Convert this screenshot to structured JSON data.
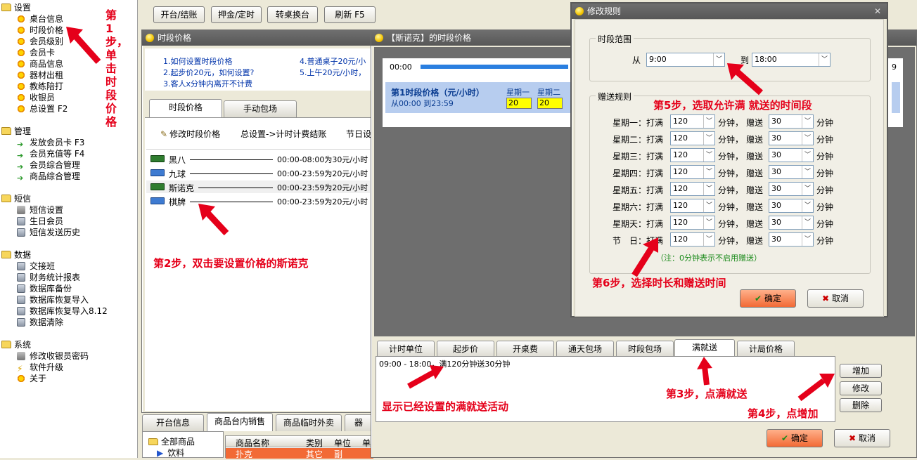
{
  "sidebar": {
    "groups": [
      {
        "label": "设置",
        "items": [
          "桌台信息",
          "时段价格",
          "会员级别",
          "会员卡",
          "商品信息",
          "器材出租",
          "教练陪打",
          "收银员",
          "总设置 F2"
        ]
      },
      {
        "label": "管理",
        "items": [
          "发放会员卡 F3",
          "会员充值等 F4",
          "会员综合管理",
          "商品综合管理"
        ]
      },
      {
        "label": "短信",
        "items": [
          "短信设置",
          "生日会员",
          "短信发送历史"
        ]
      },
      {
        "label": "数据",
        "items": [
          "交接班",
          "财务统计报表",
          "数据库备份",
          "数据库恢复导入",
          "数据库恢复导入8.12",
          "数据清除"
        ]
      },
      {
        "label": "系统",
        "items": [
          "修改收银员密码",
          "软件升级",
          "关于"
        ]
      }
    ]
  },
  "toolbar": {
    "btn1": "开台/结账",
    "btn2": "押金/定时",
    "btn3": "转桌换台",
    "btn4": "刷新 F5"
  },
  "step1": "第1步，单击时段价格",
  "win1": {
    "title": "时段价格",
    "tips": [
      "1.如何设置时段价格",
      "2.起步价20元，如何设置?",
      "3.客人x分钟内离开不计费",
      "4.普通桌子20元/小",
      "5.上午20元/小时，"
    ],
    "tabs": [
      "时段价格",
      "手动包场"
    ],
    "actions": [
      "修改时段价格",
      "总设置->计时计费结账",
      "节日设"
    ],
    "rows": [
      {
        "name": "黑八",
        "price": "00:00-08:00为30元/小时"
      },
      {
        "name": "九球",
        "price": "00:00-23:59为20元/小时"
      },
      {
        "name": "斯诺克",
        "price": "00:00-23:59为20元/小时"
      },
      {
        "name": "棋牌",
        "price": "00:00-23:59为20元/小时"
      }
    ],
    "step2": "第2步，双击要设置价格的斯诺克"
  },
  "bottom": {
    "tabs": [
      "开台信息",
      "商品台内销售",
      "商品临时外卖",
      "器"
    ],
    "tree_root": "全部商品",
    "tree_child": "饮料",
    "cols": [
      "商品名称",
      "类别",
      "单位",
      "单"
    ],
    "row": [
      "扑克",
      "其它",
      "副"
    ]
  },
  "win2": {
    "title": "【斯诺克】的时段价格",
    "time_start": "00:00",
    "time_end": "9",
    "period_title": "第1时段价格（元/小时）",
    "period_range": "从00:00 到23:59",
    "weekdays": [
      "星期一",
      "星期二"
    ],
    "weekday_values": [
      "20",
      "20"
    ],
    "tabs": [
      "计时单位",
      "起步价",
      "开桌费",
      "通天包场",
      "时段包场",
      "满就送",
      "计局价格"
    ],
    "list_item": "09:00 - 18:00，满120分钟送30分钟",
    "buttons": {
      "add": "增加",
      "edit": "修改",
      "delete": "删除"
    },
    "ok": "确定",
    "cancel": "取消",
    "step3": "第3步，点满就送",
    "step4": "第4步，点增加",
    "note": "显示已经设置的满就送活动"
  },
  "win3": {
    "title": "修改规则",
    "range_label": "时段范围",
    "from": "从",
    "to": "到",
    "from_val": "9:00",
    "to_val": "18:00",
    "gift_label": "赠送规则",
    "rows": [
      "星期一：打满",
      "星期二：打满",
      "星期三：打满",
      "星期四：打满",
      "星期五：打满",
      "星期六：打满",
      "星期天：打满",
      "节　日：打满"
    ],
    "play_val": "120",
    "gift_val": "30",
    "min": "分钟，",
    "gift": "赠送",
    "min2": "分钟",
    "tip": "（注：0分钟表示不启用赠送）",
    "ok": "确定",
    "cancel": "取消",
    "step5": "第5步，选取允许满 就送的时间段",
    "step6": "第6步，选择时长和赠送时间"
  }
}
